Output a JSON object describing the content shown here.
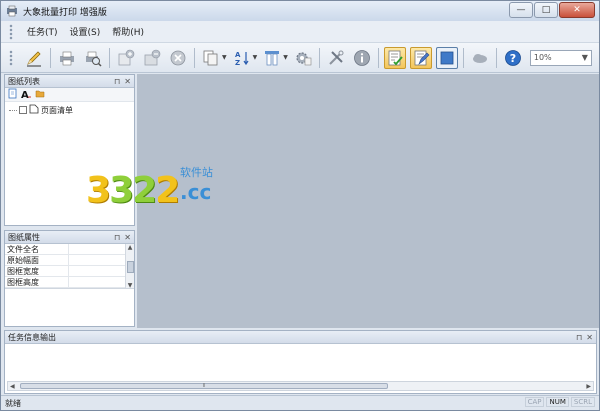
{
  "window": {
    "title": "大象批量打印 增强版",
    "controls": [
      "—",
      "□",
      "✕"
    ]
  },
  "menubar": {
    "items": [
      "任务(T)",
      "设置(S)",
      "帮助(H)"
    ]
  },
  "toolbar": {
    "icons": [
      "pencil-icon",
      "print-icon",
      "print-search-icon",
      "add-page-icon",
      "add-folder-icon",
      "delete-icon",
      "copy-icon",
      "sort-az-icon",
      "columns-icon",
      "gear-icon",
      "tools-icon",
      "info-icon",
      "checklist-icon",
      "edit-list-icon",
      "blue-square-icon",
      "cloud-icon",
      "help-icon"
    ],
    "zoom_value": "10%"
  },
  "panels": {
    "drawing_list": {
      "title": "图纸列表",
      "tree_root": "页面清单"
    },
    "drawing_props": {
      "title": "图纸属性",
      "rows": [
        "文件全名",
        "原始幅面",
        "图框宽度",
        "图框高度"
      ]
    },
    "output": {
      "title": "任务信息输出"
    }
  },
  "watermark": {
    "number": "3322",
    "cn": "软件站",
    "domain": ".cc"
  },
  "statusbar": {
    "text": "就绪",
    "indicators": [
      "CAP",
      "NUM",
      "SCRL"
    ]
  },
  "colors": {
    "workspace": "#b5bfcc",
    "panel_head": "#d3dce9",
    "watermark_yellow": "#f2c21b",
    "watermark_green": "#8fcf3a",
    "watermark_blue": "#3a8fd6"
  }
}
